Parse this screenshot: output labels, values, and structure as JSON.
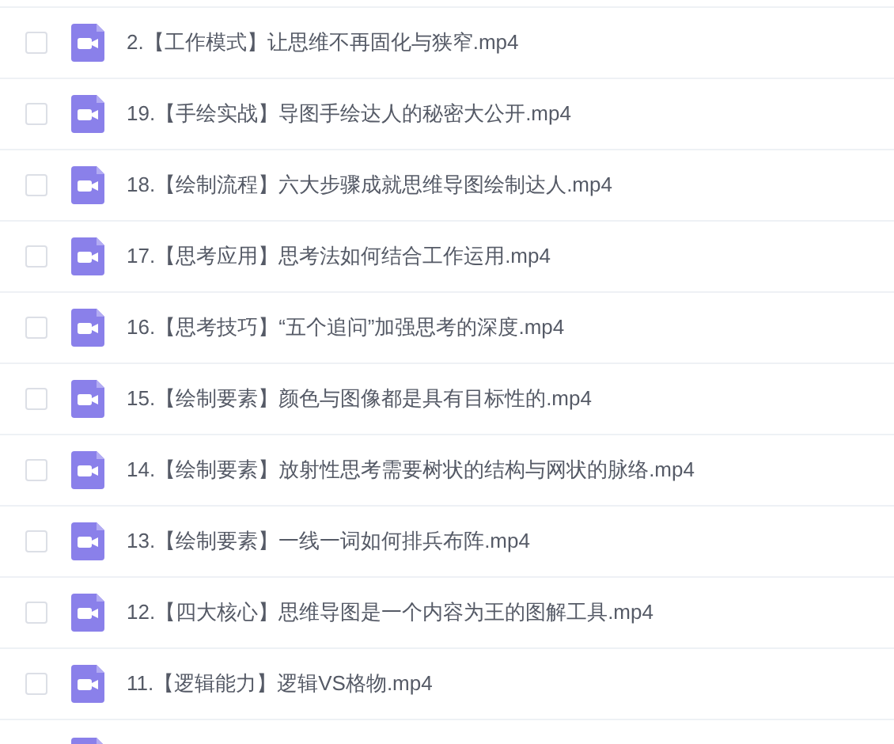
{
  "files": [
    {
      "kind": "file",
      "name": "2.【工作模式】让思维不再固化与狭窄.mp4",
      "checked": false
    },
    {
      "kind": "file",
      "name": "19.【手绘实战】导图手绘达人的秘密大公开.mp4",
      "checked": false
    },
    {
      "kind": "file",
      "name": "18.【绘制流程】六大步骤成就思维导图绘制达人.mp4",
      "checked": false
    },
    {
      "kind": "file",
      "name": "17.【思考应用】思考法如何结合工作运用.mp4",
      "checked": false
    },
    {
      "kind": "file",
      "name": "16.【思考技巧】“五个追问”加强思考的深度.mp4",
      "checked": false
    },
    {
      "kind": "file",
      "name": "15.【绘制要素】颜色与图像都是具有目标性的.mp4",
      "checked": false
    },
    {
      "kind": "file",
      "name": "14.【绘制要素】放射性思考需要树状的结构与网状的脉络.mp4",
      "checked": false
    },
    {
      "kind": "file",
      "name": "13.【绘制要素】一线一词如何排兵布阵.mp4",
      "checked": false
    },
    {
      "kind": "file",
      "name": "12.【四大核心】思维导图是一个内容为王的图解工具.mp4",
      "checked": false
    },
    {
      "kind": "file",
      "name": "11.【逻辑能力】逻辑VS格物.mp4",
      "checked": false
    },
    {
      "kind": "cut_off"
    }
  ]
}
